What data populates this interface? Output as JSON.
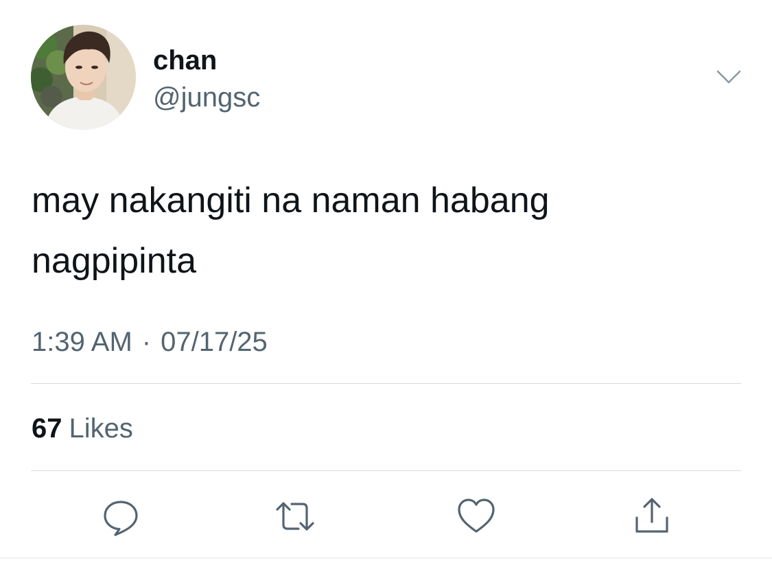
{
  "user": {
    "display_name": "chan",
    "handle": "@jungsc"
  },
  "tweet": {
    "text": "may nakangiti na naman habang\nnagpipinta",
    "time": "1:39 AM",
    "separator": "·",
    "date": "07/17/25"
  },
  "stats": {
    "likes_count": "67",
    "likes_label": "Likes"
  },
  "actions": [
    {
      "name": "reply",
      "icon": "comment-icon"
    },
    {
      "name": "retweet",
      "icon": "retweet-icon"
    },
    {
      "name": "like",
      "icon": "heart-icon"
    },
    {
      "name": "share",
      "icon": "share-icon"
    }
  ],
  "colors": {
    "text_primary": "#0f1419",
    "text_secondary": "#536471",
    "icon": "#536471",
    "divider": "#d5dadd"
  }
}
